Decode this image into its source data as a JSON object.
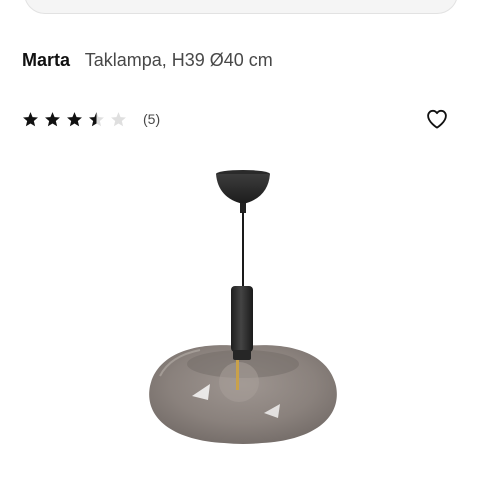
{
  "product": {
    "name": "Marta",
    "description": "Taklampa, H39 Ø40 cm"
  },
  "rating": {
    "value": 3.5,
    "max": 5,
    "count_label": "(5)"
  },
  "icons": {
    "star": "star-icon",
    "favorite": "heart-icon"
  },
  "colors": {
    "star_filled": "#111111",
    "star_empty": "#dfdfdf",
    "text_secondary": "#484848"
  }
}
